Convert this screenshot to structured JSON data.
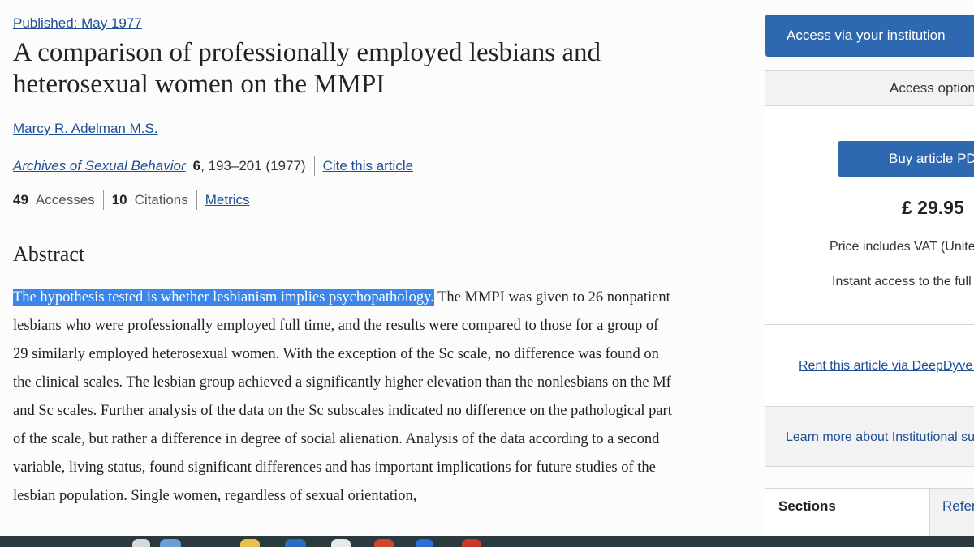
{
  "article": {
    "published": "Published: May 1977",
    "title": "A comparison of professionally employed lesbians and heterosexual women on the MMPI",
    "author": "Marcy R. Adelman M.S.",
    "journal": "Archives of Sexual Behavior",
    "volume": "6",
    "pages": ", 193–201 (1977)",
    "cite_label": "Cite this article",
    "accesses_count": "49",
    "accesses_label": "Accesses",
    "citations_count": "10",
    "citations_label": "Citations",
    "metrics_label": "Metrics",
    "abstract_heading": "Abstract",
    "abstract_highlight": "The hypothesis tested is whether lesbianism implies psychopathology.",
    "abstract_body": " The MMPI was given to 26 nonpatient lesbians who were professionally employed full time, and the results were compared to those for a group of 29 similarly employed heterosexual women. With the exception of the Sc scale, no difference was found on the clinical scales. The lesbian group achieved a significantly higher elevation than the nonlesbians on the Mf and Sc scales. Further analysis of the data on the Sc subscales indicated no difference on the pathological part of the scale, but rather a difference in degree of social alienation. Analysis of the data according to a second variable, living status, found significant differences and has important implications for future studies of the lesbian population. Single women, regardless of sexual orientation,"
  },
  "access": {
    "institution_button": "Access via your institution",
    "options_header": "Access option",
    "buy_button": "Buy article PD",
    "price": "£ 29.95",
    "vat_note": "Price includes VAT (Unite",
    "instant_note": "Instant access to the full",
    "deepdyve_link": "Rent this article via DeepDyve.",
    "learn_link": "Learn more about Institutional su"
  },
  "tabs": {
    "sections": "Sections",
    "references": "Refer"
  },
  "colors": {
    "link": "#1e4e96",
    "button": "#2d68b1",
    "highlight": "#3a86ea"
  }
}
